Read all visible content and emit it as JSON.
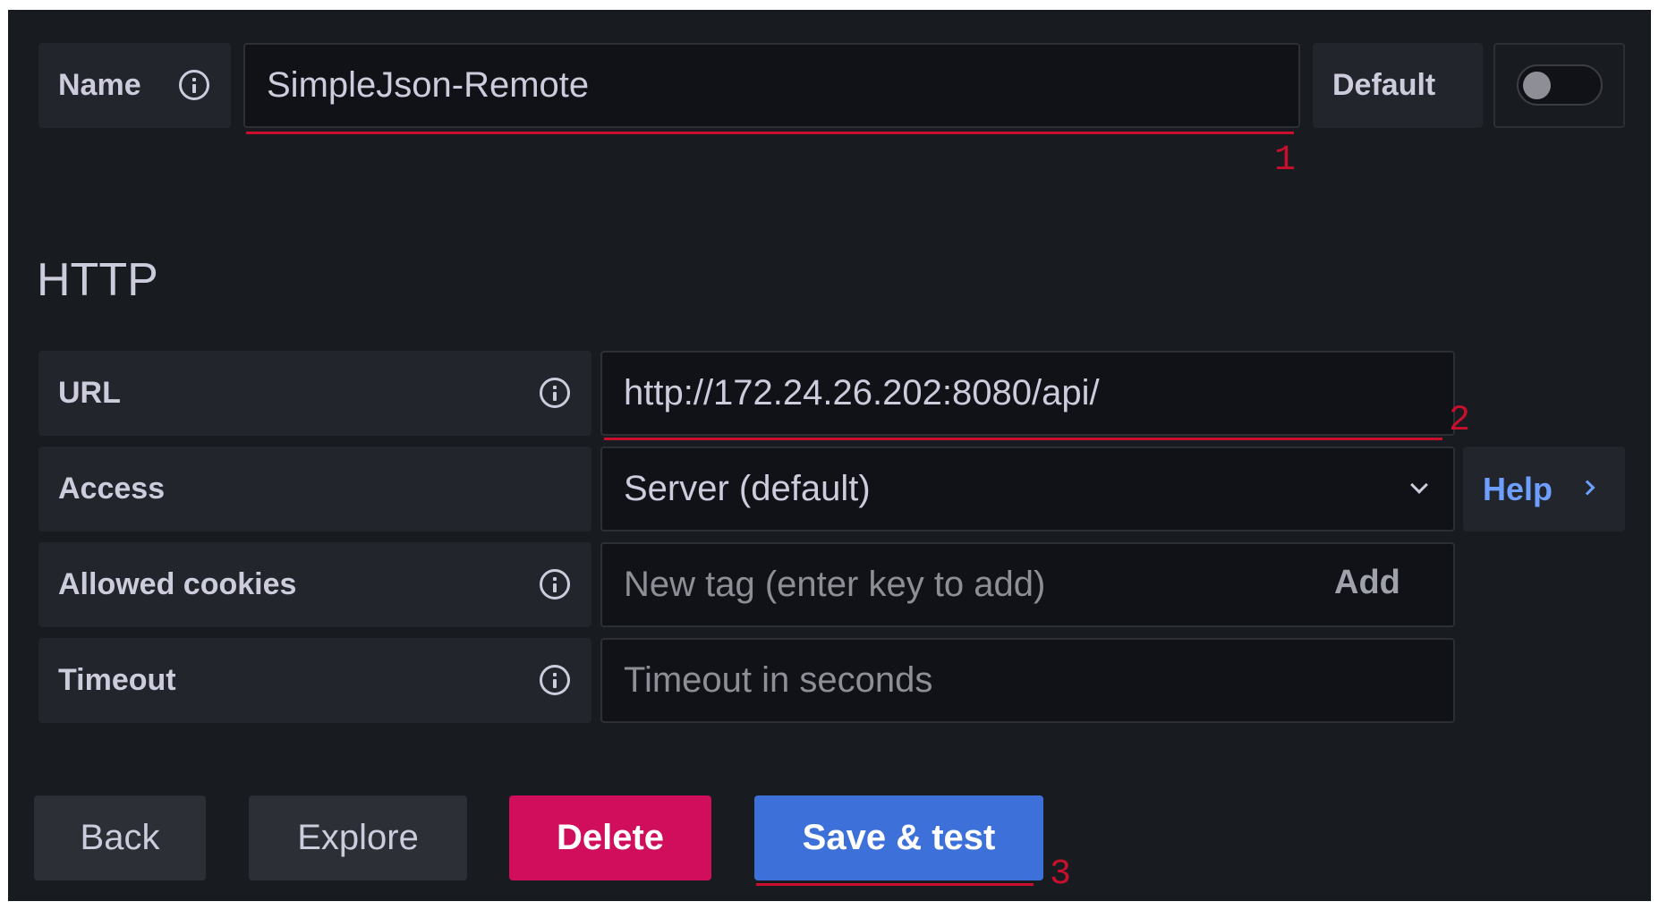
{
  "name_field": {
    "label": "Name",
    "value": "SimpleJson-Remote",
    "default_label": "Default",
    "default_enabled": false
  },
  "section_title": "HTTP",
  "http": {
    "url": {
      "label": "URL",
      "value": "http://172.24.26.202:8080/api/"
    },
    "access": {
      "label": "Access",
      "value": "Server (default)",
      "help_label": "Help"
    },
    "allowed_cookies": {
      "label": "Allowed cookies",
      "placeholder": "New tag (enter key to add)",
      "add_label": "Add"
    },
    "timeout": {
      "label": "Timeout",
      "placeholder": "Timeout in seconds"
    }
  },
  "buttons": {
    "back": "Back",
    "explore": "Explore",
    "delete": "Delete",
    "save_test": "Save & test"
  },
  "annotations": [
    "1",
    "2",
    "3"
  ],
  "colors": {
    "background": "#181b1f",
    "label_bg": "#22252b",
    "input_bg": "#111217",
    "delete": "#d10e5c",
    "primary": "#3d71d9",
    "link": "#6e9fff",
    "annotation": "#c8102e"
  }
}
